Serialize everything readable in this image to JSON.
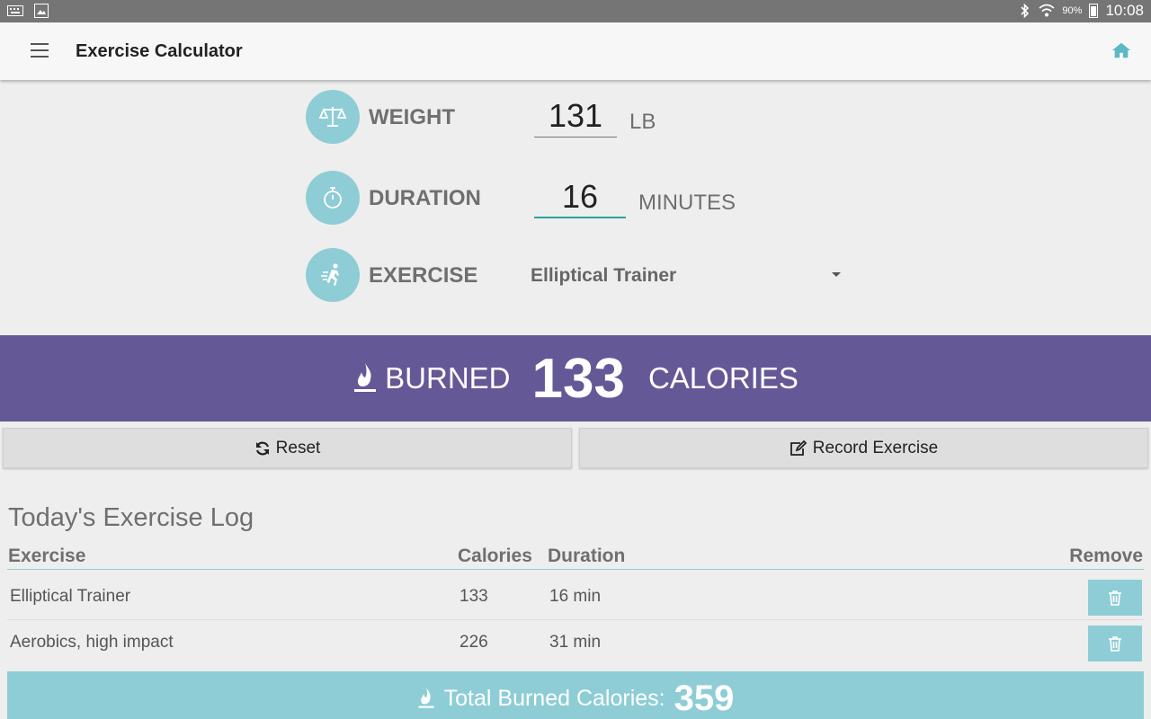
{
  "status_bar": {
    "battery_pct": "90%",
    "time": "10:08"
  },
  "app_bar": {
    "title": "Exercise Calculator"
  },
  "form": {
    "weight": {
      "label": "WEIGHT",
      "value": "131",
      "unit": "LB"
    },
    "duration": {
      "label": "DURATION",
      "value": "16",
      "unit": "MINUTES"
    },
    "exercise": {
      "label": "EXERCISE",
      "selected": "Elliptical Trainer"
    }
  },
  "burned": {
    "prefix": "BURNED",
    "calories": "133",
    "suffix": "CALORIES"
  },
  "buttons": {
    "reset": "Reset",
    "record": "Record Exercise"
  },
  "log": {
    "title": "Today's Exercise Log",
    "headers": {
      "exercise": "Exercise",
      "calories": "Calories",
      "duration": "Duration",
      "remove": "Remove"
    },
    "rows": [
      {
        "exercise": "Elliptical Trainer",
        "calories": "133",
        "duration": "16 min"
      },
      {
        "exercise": "Aerobics, high impact",
        "calories": "226",
        "duration": "31 min"
      }
    ]
  },
  "total": {
    "label": "Total Burned Calories:",
    "value": "359"
  },
  "colors": {
    "accent": "#8ecdd5",
    "banner": "#645896",
    "active_field": "#26a69a"
  }
}
